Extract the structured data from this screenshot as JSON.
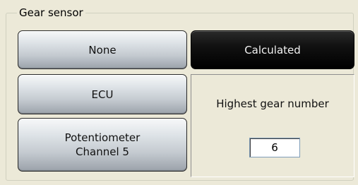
{
  "group": {
    "title": "Gear sensor"
  },
  "buttons": {
    "none": "None",
    "ecu": "ECU",
    "potentiometer": "Potentiometer\nChannel 5",
    "calculated": "Calculated"
  },
  "calculated_panel": {
    "label": "Highest gear number",
    "value": "6"
  },
  "colors": {
    "selected_button": "#000000",
    "selected_text": "#f2f2f2",
    "background": "#ece9d8"
  }
}
